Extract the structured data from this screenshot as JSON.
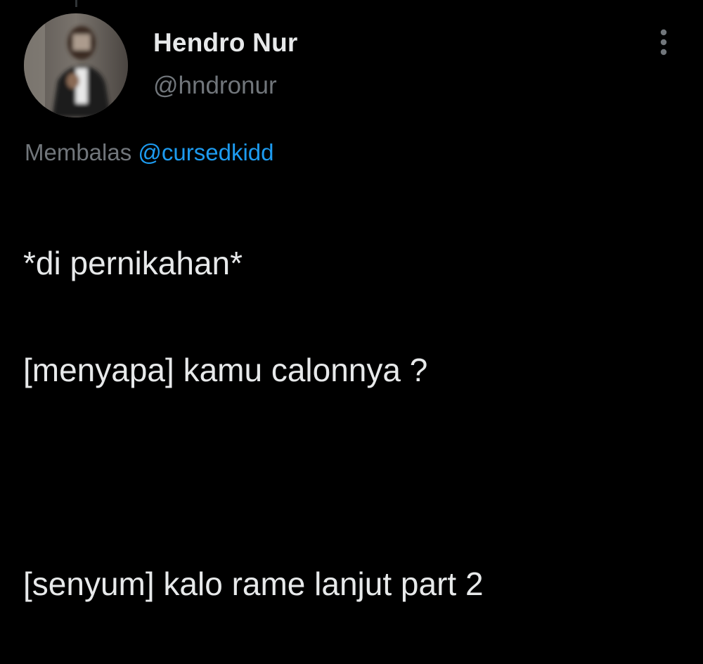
{
  "tweet": {
    "author": {
      "name": "Hendro Nur",
      "handle": "@hndronur",
      "avatar_icon": "profile-photo"
    },
    "more_icon": "more-vertical-icon",
    "reply_context": {
      "prefix": "Membalas",
      "mention": "@cursedkidd"
    },
    "lines": [
      "*di pernikahan*",
      "[menyapa] kamu calonnya ?",
      "",
      "[senyum] kalo rame lanjut part 2"
    ]
  },
  "colors": {
    "background": "#000000",
    "text_primary": "#e7e9ea",
    "text_secondary": "#71767b",
    "accent": "#1d9bf0"
  }
}
